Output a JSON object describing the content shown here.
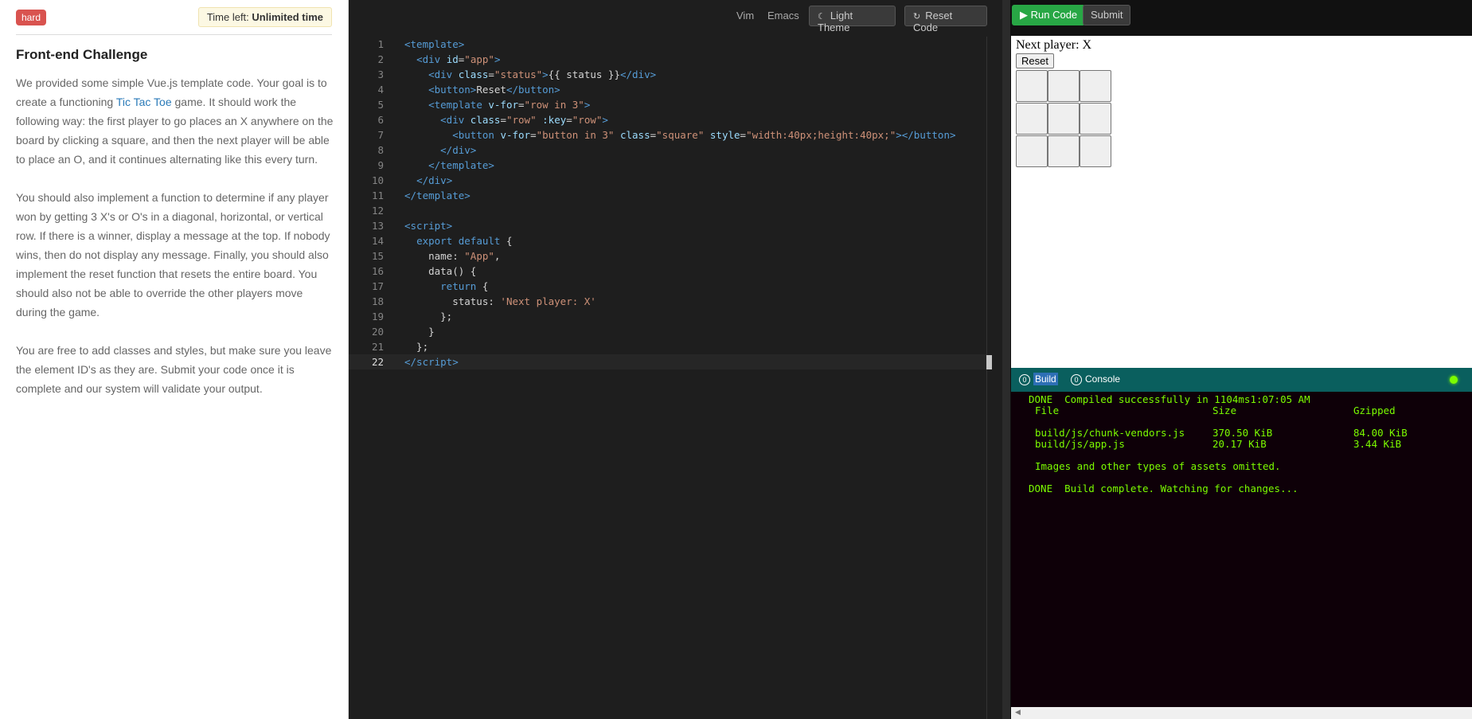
{
  "challenge": {
    "difficulty": "hard",
    "time_left_label": "Time left:",
    "time_left_value": "Unlimited time",
    "title": "Front-end Challenge",
    "para1_a": "We provided some simple Vue.js template code. Your goal is to create a functioning ",
    "para1_link": "Tic Tac Toe",
    "para1_b": " game. It should work the following way: the first player to go places an X anywhere on the board by clicking a square, and then the next player will be able to place an O, and it continues alternating like this every turn.",
    "para2": "You should also implement a function to determine if any player won by getting 3 X's or O's in a diagonal, horizontal, or vertical row. If there is a winner, display a message at the top. If nobody wins, then do not display any message. Finally, you should also implement the reset function that resets the entire board. You should also not be able to override the other players move during the game.",
    "para3": "You are free to add classes and styles, but make sure you leave the element ID's as they are. Submit your code once it is complete and our system will validate your output."
  },
  "toolbar": {
    "vim": "Vim",
    "emacs": "Emacs",
    "light_theme": "Light Theme",
    "reset_code": "Reset Code",
    "moon_icon": "moon-icon",
    "reset_icon": "refresh-icon"
  },
  "code_lines": [
    "1",
    "2",
    "3",
    "4",
    "5",
    "6",
    "7",
    "8",
    "9",
    "10",
    "11",
    "12",
    "13",
    "14",
    "15",
    "16",
    "17",
    "18",
    "19",
    "20",
    "21",
    "22"
  ],
  "actions": {
    "run": "Run Code",
    "submit": "Submit"
  },
  "preview": {
    "status": "Next player: X",
    "reset": "Reset"
  },
  "console": {
    "tab_build_count": "0",
    "tab_build": "Build",
    "tab_console_count": "0",
    "tab_console": "Console",
    "line1": "DONE  Compiled successfully in 1104ms1:07:05 AM",
    "col_file": "File",
    "col_size": "Size",
    "col_gzip": "Gzipped",
    "f1_name": "build/js/chunk-vendors.js",
    "f1_size": "370.50 KiB",
    "f1_gzip": "84.00 KiB",
    "f2_name": "build/js/app.js",
    "f2_size": "20.17 KiB",
    "f2_gzip": "3.44 KiB",
    "omitted": "Images and other types of assets omitted.",
    "done": "DONE  Build complete. Watching for changes..."
  },
  "colors": {
    "difficulty_badge": "#d9534f",
    "run_button": "#28a745",
    "console_tabbar": "#0a5f5e",
    "console_text": "#7cfc00"
  }
}
